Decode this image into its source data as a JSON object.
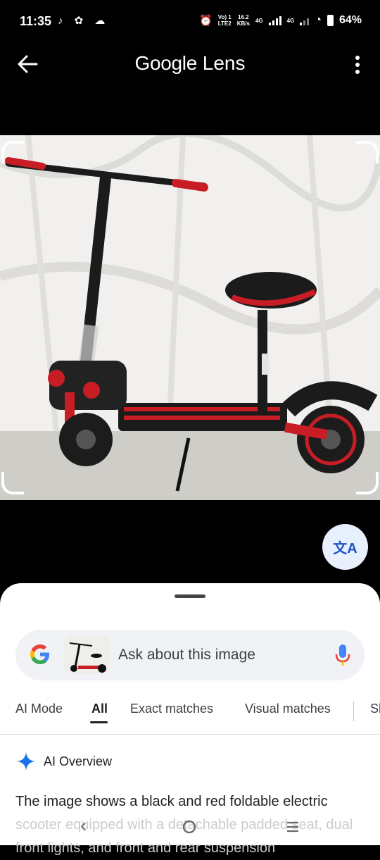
{
  "status": {
    "time": "11:35",
    "volte": "Vo) 1\nLTE2",
    "speed_value": "16.2",
    "speed_unit": "KB/s",
    "net1": "4G",
    "net2": "4G",
    "battery": "64%"
  },
  "appbar": {
    "title_google": "Google",
    "title_lens": "Lens"
  },
  "search": {
    "placeholder": "Ask about this image"
  },
  "tabs": [
    "AI Mode",
    "All",
    "Exact matches",
    "Visual matches",
    "Sh"
  ],
  "active_tab": "All",
  "ai_overview": {
    "title": "AI Overview",
    "text_visible": "The image shows a black and red foldable electric",
    "text_faded": "scooter equipped with a detachable padded seat, dual front lights, and front and rear suspension"
  },
  "translate_icon": "translate-icon",
  "colors": {
    "accent_blue": "#1a73e8",
    "scooter_red": "#d62828"
  }
}
